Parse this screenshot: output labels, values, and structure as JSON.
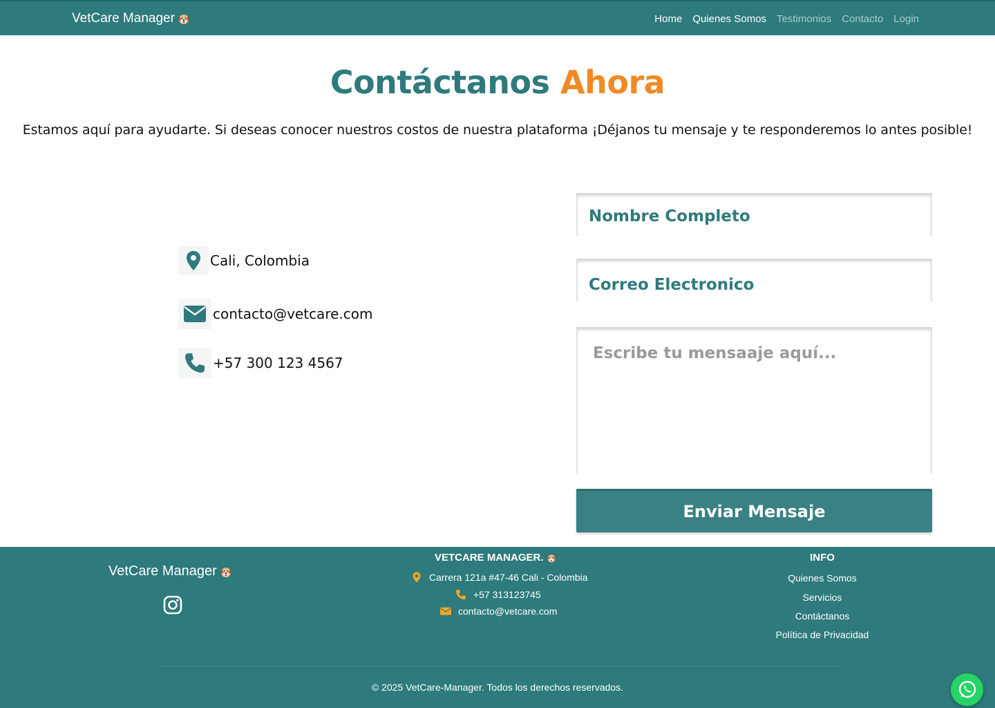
{
  "navbar": {
    "brand": "VetCare Manager",
    "links": [
      "Home",
      "Quienes Somos",
      "Testimonios",
      "Contacto",
      "Login"
    ]
  },
  "hero": {
    "title_part1": "Contáctanos",
    "title_part2": "Ahora",
    "subtitle": "Estamos aquí para ayudarte. Si deseas conocer nuestros costos de nuestra plataforma ¡Déjanos tu mensaje y te responderemos lo antes posible!"
  },
  "contact_info": {
    "location": "Cali, Colombia",
    "email": "contacto@vetcare.com",
    "phone": "+57 300 123 4567"
  },
  "form": {
    "name_label": "Nombre Completo",
    "email_label": "Correo Electronico",
    "message_placeholder": "Escribe tu mensaaje aquí...",
    "submit_label": "Enviar Mensaje"
  },
  "footer": {
    "brand": "VetCare Manager",
    "center_title": "VETCARE MANAGER.",
    "address": "Carrera 121a #47-46 Cali - Colombia",
    "phone": "+57 313123745",
    "email": "contacto@vetcare.com",
    "info_title": "INFO",
    "info_links": [
      "Quienes Somos",
      "Servicios",
      "Contáctanos",
      "Política de Privacidad"
    ],
    "copyright": "© 2025 VetCare-Manager. Todos los derechos reservados."
  },
  "colors": {
    "primary": "#2e7a7c",
    "accent": "#f08a24",
    "whatsapp": "#25d366"
  },
  "icons": [
    "dog-icon",
    "location-pin-icon",
    "envelope-icon",
    "phone-icon",
    "instagram-icon",
    "whatsapp-icon"
  ]
}
